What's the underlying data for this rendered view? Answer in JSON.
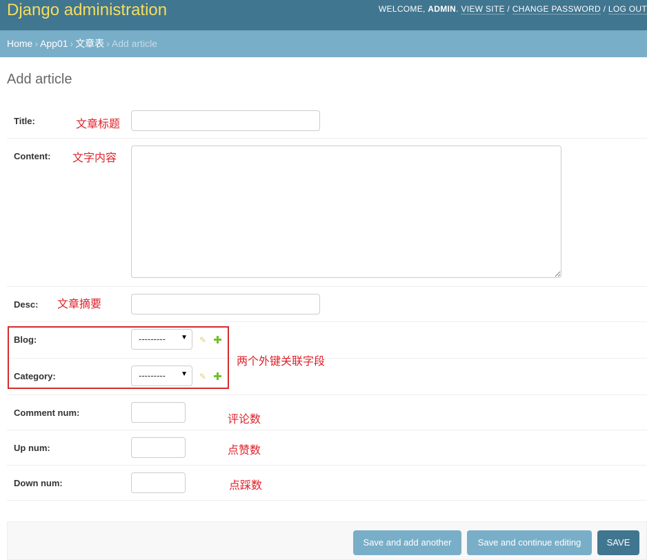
{
  "header": {
    "site_title": "Django administration",
    "welcome_text": "WELCOME, ",
    "username": "ADMIN",
    "view_site": "VIEW SITE",
    "change_password": "CHANGE PASSWORD",
    "log_out": "LOG OUT",
    "separator": " / "
  },
  "breadcrumbs": {
    "items": [
      "Home",
      "App01",
      "文章表"
    ],
    "current": "Add article",
    "separator": "›"
  },
  "page_title": "Add article",
  "form": {
    "title_label": "Title:",
    "content_label": "Content:",
    "desc_label": "Desc:",
    "blog_label": "Blog:",
    "category_label": "Category:",
    "comment_num_label": "Comment num:",
    "up_num_label": "Up num:",
    "down_num_label": "Down num:",
    "blog_selected": "---------",
    "category_selected": "---------"
  },
  "annotations": {
    "title": "文章标题",
    "content": "文字内容",
    "desc": "文章摘要",
    "foreign_keys": "两个外键关联字段",
    "comment_num": "评论数",
    "up_num": "点赞数",
    "down_num": "点踩数"
  },
  "buttons": {
    "save_add_another": "Save and add another",
    "save_continue": "Save and continue editing",
    "save": "SAVE"
  },
  "colors": {
    "header_bg": "#417690",
    "site_title": "#f5dd5d",
    "breadcrumbs_bg": "#79aec8",
    "button_bg": "#79aec8",
    "save_button_bg": "#417690",
    "annotation": "#e0212a"
  }
}
